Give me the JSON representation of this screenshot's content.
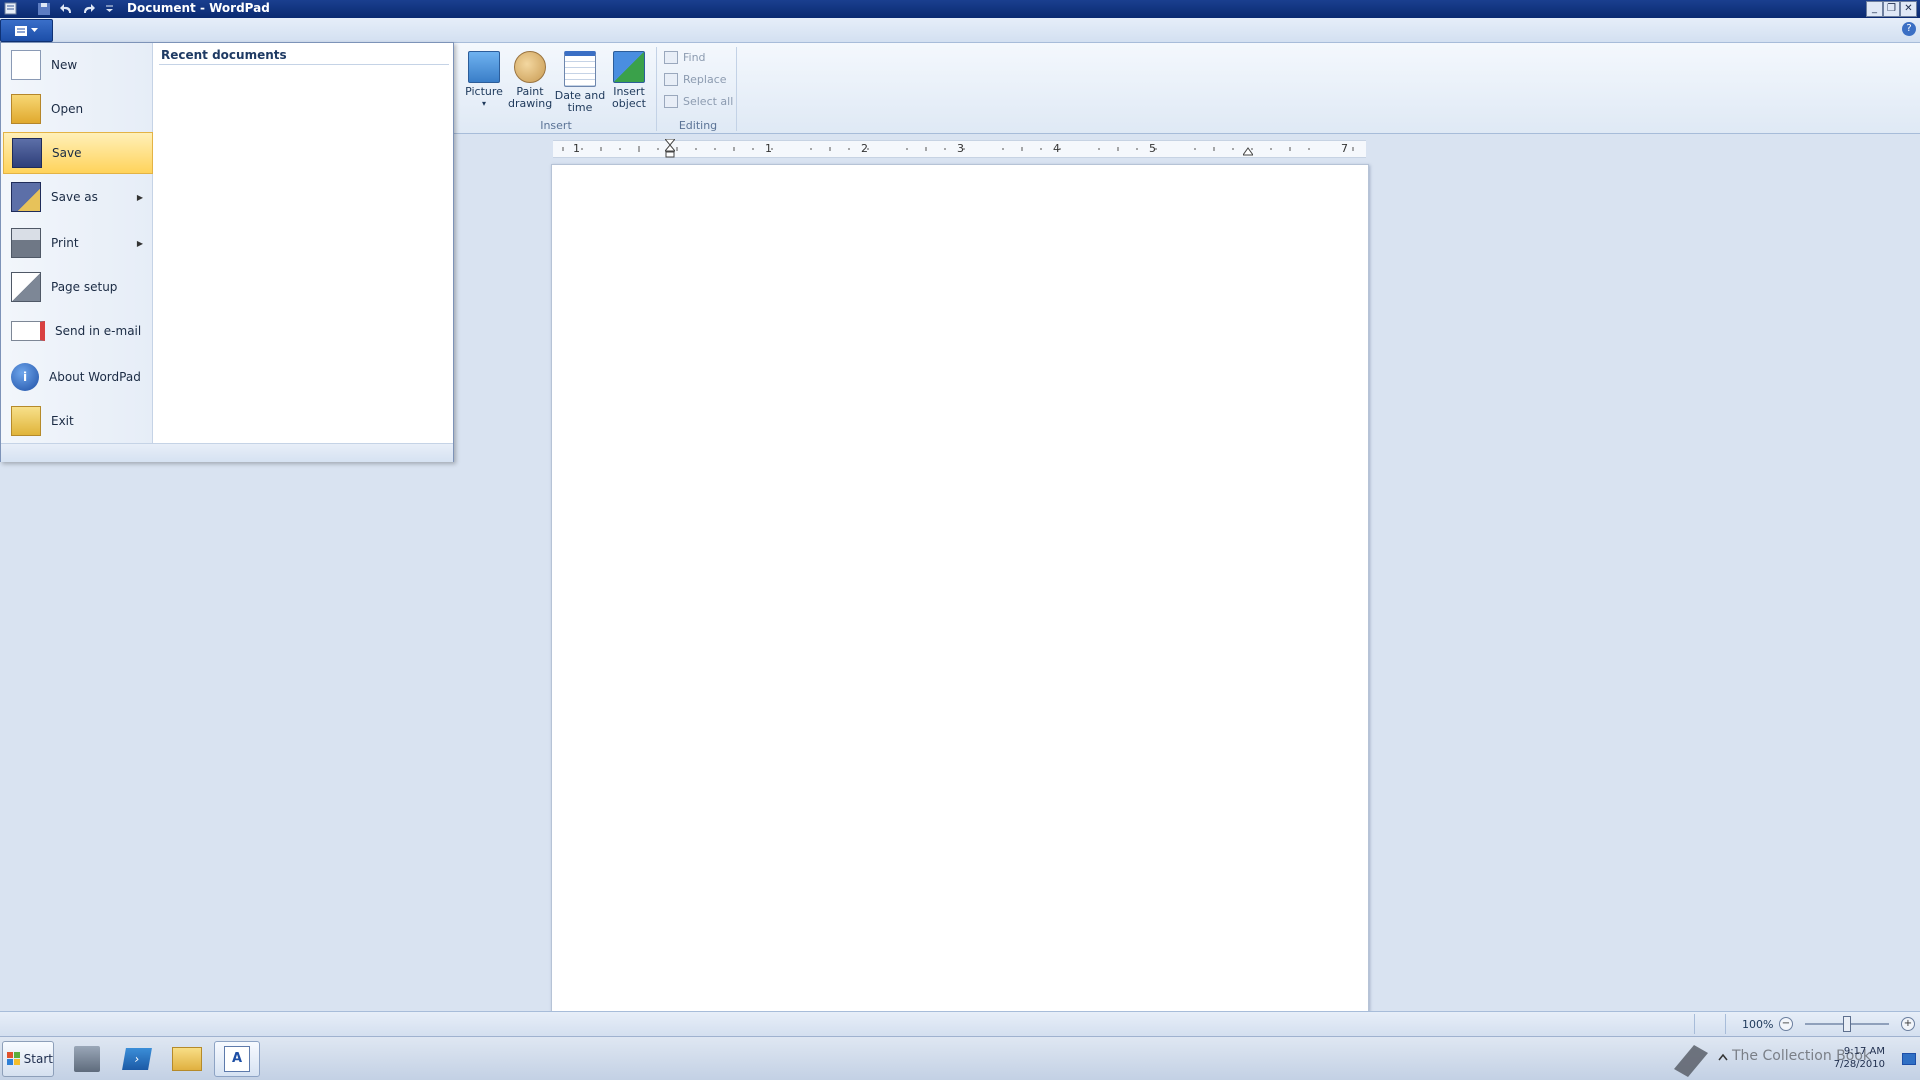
{
  "window": {
    "title": "Document - WordPad"
  },
  "colors": {
    "titlebar": "#0d2f7a",
    "highlight": "#ffd35b",
    "ribbon": "#dfe9f5",
    "page": "#ffffff"
  },
  "ribbon": {
    "insert_group": {
      "label": "Insert",
      "buttons": [
        {
          "label_line1": "Picture",
          "label_line2": "▾",
          "icon": "picture-icon"
        },
        {
          "label_line1": "Paint",
          "label_line2": "drawing",
          "icon": "paint-drawing-icon"
        },
        {
          "label_line1": "Date and",
          "label_line2": "time",
          "icon": "calendar-clock-icon"
        },
        {
          "label_line1": "Insert",
          "label_line2": "object",
          "icon": "insert-object-icon"
        }
      ]
    },
    "editing_group": {
      "label": "Editing",
      "items": [
        {
          "label": "Find",
          "icon": "binoculars-icon"
        },
        {
          "label": "Replace",
          "icon": "replace-icon"
        },
        {
          "label": "Select all",
          "icon": "select-all-icon"
        }
      ]
    }
  },
  "file_menu": {
    "recent_title": "Recent documents",
    "items": [
      {
        "label": "New",
        "icon": "new-document-icon"
      },
      {
        "label": "Open",
        "icon": "open-folder-icon"
      },
      {
        "label": "Save",
        "icon": "save-disk-icon",
        "highlighted": true
      },
      {
        "label": "Save as",
        "icon": "save-as-icon",
        "submenu": true
      },
      {
        "label": "Print",
        "icon": "printer-icon",
        "submenu": true
      },
      {
        "label": "Page setup",
        "icon": "page-setup-icon"
      },
      {
        "label": "Send in e-mail",
        "icon": "email-icon"
      },
      {
        "label": "About WordPad",
        "icon": "info-icon"
      },
      {
        "label": "Exit",
        "icon": "exit-icon"
      }
    ]
  },
  "ruler": {
    "labels": [
      "1",
      "1",
      "2",
      "3",
      "4",
      "5",
      "7"
    ]
  },
  "status": {
    "zoom": "100%",
    "zoom_minus": "−",
    "zoom_plus": "+",
    "zoom_level_percent": 100
  },
  "taskbar": {
    "start_label": "Start",
    "time": "9:17 AM",
    "date": "7/28/2010",
    "watermark": "The Collection Book"
  }
}
